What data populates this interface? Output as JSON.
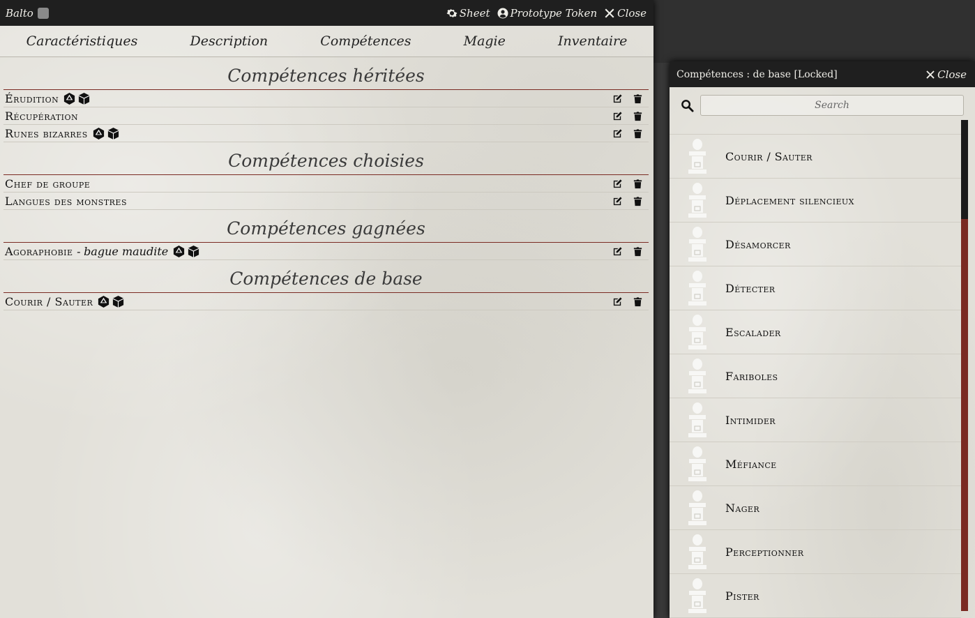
{
  "sheet": {
    "title": "Balto",
    "controls": {
      "sheet": "Sheet",
      "token": "Prototype Token",
      "close": "Close"
    },
    "tabs": [
      "Caractéristiques",
      "Description",
      "Compétences",
      "Magie",
      "Inventaire"
    ],
    "sections": [
      {
        "title": "Compétences héritées",
        "skills": [
          {
            "name": "Érudition",
            "sub": "",
            "dice": true
          },
          {
            "name": "Récupération",
            "sub": "",
            "dice": false
          },
          {
            "name": "Runes bizarres",
            "sub": "",
            "dice": true
          }
        ]
      },
      {
        "title": "Compétences choisies",
        "skills": [
          {
            "name": "Chef de groupe",
            "sub": "",
            "dice": false
          },
          {
            "name": "Langues des monstres",
            "sub": "",
            "dice": false
          }
        ]
      },
      {
        "title": "Compétences gagnées",
        "skills": [
          {
            "name": "Agoraphobie -",
            "sub": "bague maudite",
            "dice": true
          }
        ]
      },
      {
        "title": "Compétences de base",
        "skills": [
          {
            "name": "Courir / Sauter",
            "sub": "",
            "dice": true
          }
        ]
      }
    ]
  },
  "compendium": {
    "title": "Compétences : de base [Locked]",
    "close": "Close",
    "search_placeholder": "Search",
    "items": [
      "Courir / Sauter",
      "Déplacement silencieux",
      "Désamorcer",
      "Détecter",
      "Escalader",
      "Fariboles",
      "Intimider",
      "Méfiance",
      "Nager",
      "Perceptionner",
      "Pister"
    ]
  },
  "colors": {
    "accent_rule": "#7a2a22",
    "header_bg": "#1f1f1f",
    "parchment": "#e2e0d9"
  }
}
